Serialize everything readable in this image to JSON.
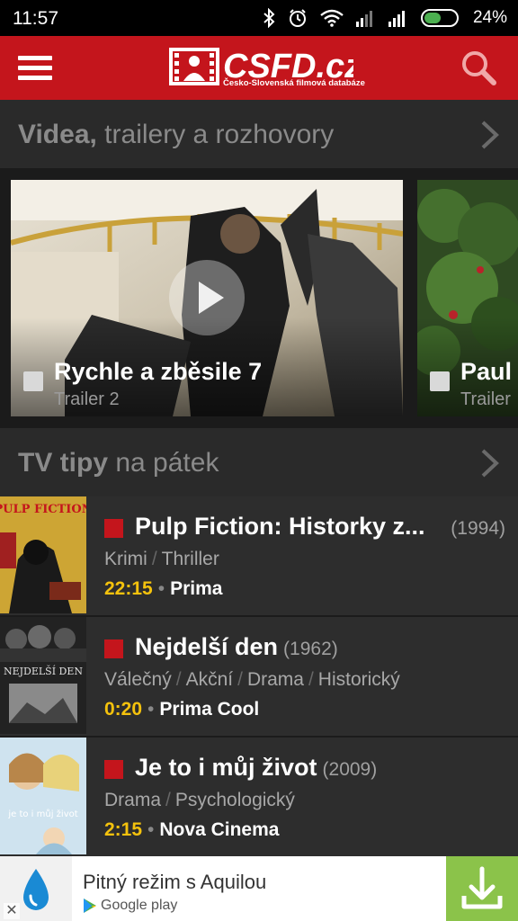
{
  "status_bar": {
    "time": "11:57",
    "battery": "24%",
    "icons": [
      "bluetooth-icon",
      "alarm-icon",
      "wifi-icon",
      "signal-icon",
      "signal-icon",
      "battery-icon"
    ]
  },
  "app_bar": {
    "logo_text": "CSFD.cz",
    "logo_subtitle": "Česko-Slovenská filmová databáze",
    "menu_icon": "hamburger-menu-icon",
    "search_icon": "search-icon",
    "color": "#c4151c"
  },
  "videos_section": {
    "title_bold": "Videa,",
    "title_rest": " trailery a rozhovory",
    "items": [
      {
        "title": "Rychle a zběsile 7",
        "subtitle": "Trailer 2"
      },
      {
        "title": "Paul",
        "subtitle": "Trailer"
      }
    ]
  },
  "tv_section": {
    "title_bold": "TV tipy",
    "title_rest": " na pátek",
    "items": [
      {
        "title": "Pulp Fiction: Historky z...",
        "year": "(1994)",
        "poster_text": "PULP FICTION",
        "genres": [
          "Krimi",
          "Thriller"
        ],
        "time": "22:15",
        "channel": "Prima"
      },
      {
        "title": "Nejdelší den",
        "year": "(1962)",
        "poster_text": "NEJDELŠÍ DEN",
        "genres": [
          "Válečný",
          "Akční",
          "Drama",
          "Historický"
        ],
        "time": "0:20",
        "channel": "Prima Cool"
      },
      {
        "title": "Je to i můj život",
        "year": "(2009)",
        "poster_text": "je to i můj život",
        "genres": [
          "Drama",
          "Psychologický"
        ],
        "time": "2:15",
        "channel": "Nova Cinema"
      }
    ]
  },
  "ad": {
    "text": "Pitný režim s Aquilou",
    "store": "Google play",
    "close": "✕",
    "accent": "#8bc34a"
  },
  "colors": {
    "accent": "#c4151c",
    "time": "#f4c20d",
    "background": "#1b1b1b"
  }
}
